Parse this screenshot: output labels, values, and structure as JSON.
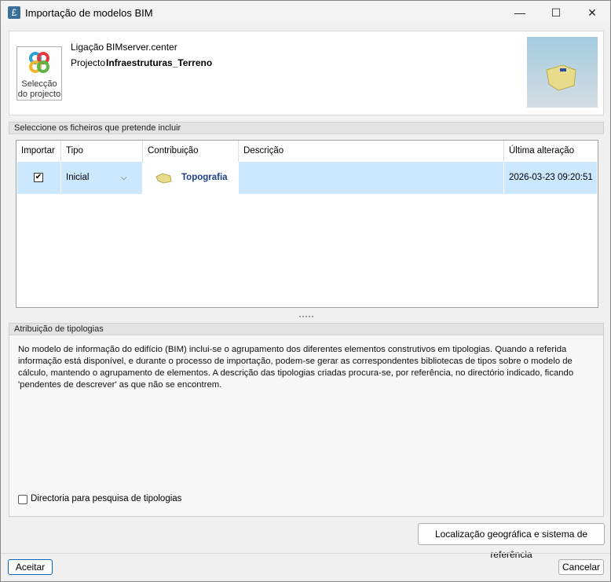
{
  "window": {
    "title": "Importação de modelos BIM",
    "minimize": "—",
    "maximize": "☐",
    "close": "✕"
  },
  "project": {
    "select_button": "Selecção do projecto",
    "link_label": "Ligação",
    "link_value": "BIMserver.center",
    "project_label": "Projecto",
    "project_value": "Infraestruturas_Terreno"
  },
  "files": {
    "section_title": "Seleccione os ficheiros que pretende incluir",
    "columns": [
      "Importar",
      "Tipo",
      "Contribuição",
      "Descrição",
      "Última alteração"
    ],
    "rows": [
      {
        "import": true,
        "type": "Inicial",
        "contribution": "Topografia",
        "description": "",
        "modified": "2026-03-23 09:20:51"
      }
    ]
  },
  "typologies": {
    "section_title": "Atribuição de tipologias",
    "description": "No modelo de informação do edifício (BIM) inclui-se o agrupamento dos diferentes elementos construtivos em tipologias. Quando a referida informação está disponível, e durante o processo de importação, podem-se gerar as correspondentes bibliotecas de tipos sobre o modelo de cálculo, mantendo o agrupamento de elementos. A descrição das tipologias criadas procura-se, por referência, no directório indicado, ficando 'pendentes de descrever' as que não se encontrem.",
    "directory_checkbox": "Directoria para pesquisa de tipologias",
    "directory_checked": false
  },
  "buttons": {
    "geo": "Localização geográfica e sistema de referência",
    "accept": "Aceitar",
    "cancel": "Cancelar"
  }
}
